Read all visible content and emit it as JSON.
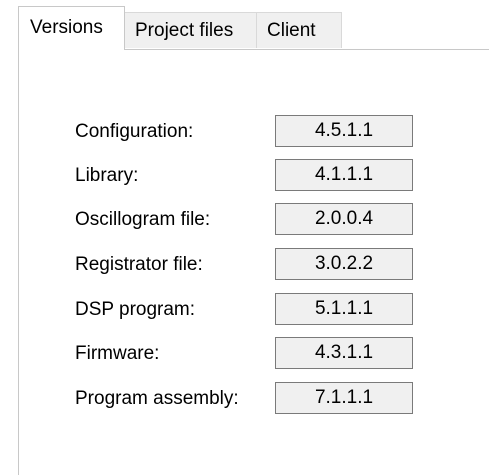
{
  "tabs": [
    {
      "label": "Versions",
      "active": true
    },
    {
      "label": "Project files",
      "active": false
    },
    {
      "label": "Client",
      "active": false
    }
  ],
  "versions": [
    {
      "label": "Configuration:",
      "value": "4.5.1.1"
    },
    {
      "label": "Library:",
      "value": "4.1.1.1"
    },
    {
      "label": "Oscillogram file:",
      "value": "2.0.0.4"
    },
    {
      "label": "Registrator file:",
      "value": "3.0.2.2"
    },
    {
      "label": "DSP program:",
      "value": "5.1.1.1"
    },
    {
      "label": "Firmware:",
      "value": "4.3.1.1"
    },
    {
      "label": "Program assembly:",
      "value": "7.1.1.1"
    }
  ]
}
